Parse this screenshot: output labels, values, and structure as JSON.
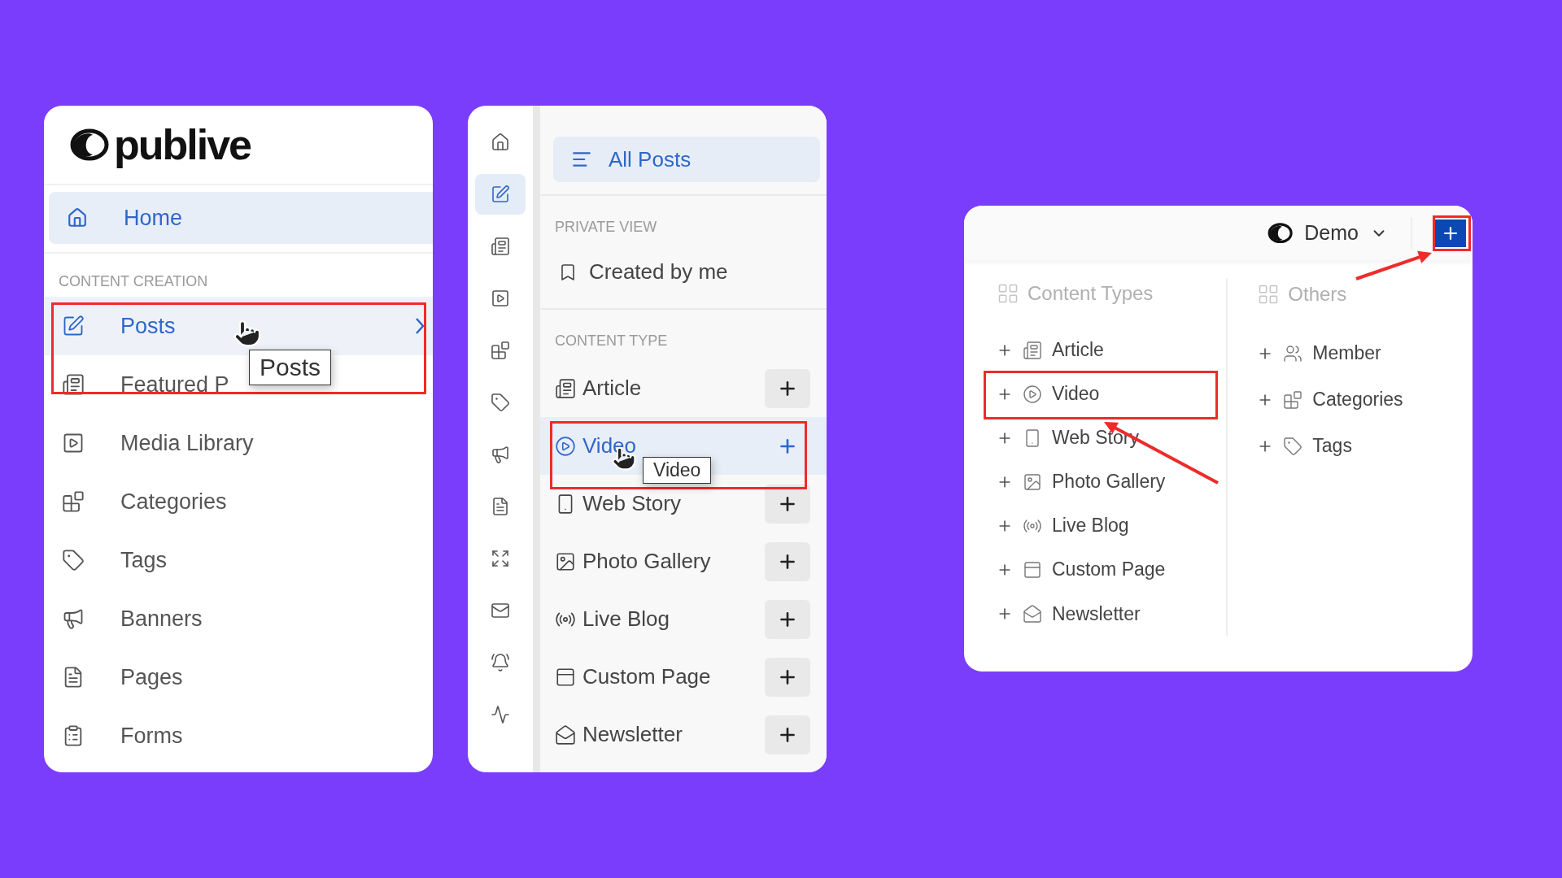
{
  "main_sidebar": {
    "logo": "publive",
    "home": {
      "label": "Home",
      "selected": true
    },
    "section": "CONTENT CREATION",
    "items": [
      {
        "label": "Posts",
        "selected": true,
        "expandable": true
      },
      {
        "label": "Featured P",
        "selected": false,
        "expandable": false
      },
      {
        "label": "Media Library",
        "selected": false,
        "expandable": false
      },
      {
        "label": "Categories",
        "selected": false,
        "expandable": false
      },
      {
        "label": "Tags",
        "selected": false,
        "expandable": false
      },
      {
        "label": "Banners",
        "selected": false,
        "expandable": false
      },
      {
        "label": "Pages",
        "selected": false,
        "expandable": false
      },
      {
        "label": "Forms",
        "selected": false,
        "expandable": false
      }
    ],
    "tooltip": "Posts"
  },
  "posts_menu": {
    "rail": [
      {
        "selected": false
      },
      {
        "selected": true
      },
      {
        "selected": false
      },
      {
        "selected": false
      },
      {
        "selected": false
      },
      {
        "selected": false
      },
      {
        "selected": false
      },
      {
        "selected": false
      },
      {
        "selected": false
      },
      {
        "selected": false
      },
      {
        "selected": false
      },
      {
        "selected": false
      }
    ],
    "all_posts": {
      "label": "All Posts",
      "selected": true
    },
    "private_section": "PRIVATE VIEW",
    "private_item": "Created by me",
    "content_section": "CONTENT TYPE",
    "items": [
      {
        "label": "Article",
        "selected": false
      },
      {
        "label": "Video",
        "selected": true
      },
      {
        "label": "Web Story",
        "selected": false
      },
      {
        "label": "Photo Gallery",
        "selected": false
      },
      {
        "label": "Live Blog",
        "selected": false
      },
      {
        "label": "Custom Page",
        "selected": false
      },
      {
        "label": "Newsletter",
        "selected": false
      }
    ],
    "tooltip": "Video"
  },
  "create_menu": {
    "workspace": "Demo",
    "columns": [
      {
        "title": "Content Types",
        "items": [
          "Article",
          "Video",
          "Web Story",
          "Photo Gallery",
          "Live Blog",
          "Custom Page",
          "Newsletter"
        ]
      },
      {
        "title": "Others",
        "items": [
          "Member",
          "Categories",
          "Tags"
        ]
      }
    ]
  }
}
